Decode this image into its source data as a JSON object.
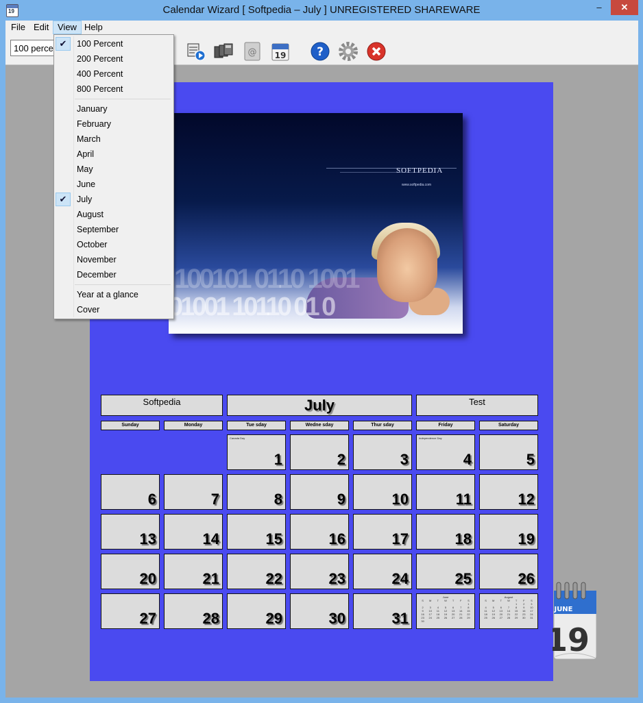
{
  "window": {
    "title": "Calendar Wizard [ Softpedia – July ]  UNREGISTERED SHAREWARE",
    "app_icon_text": "19",
    "minimize": "–",
    "maximize": "□",
    "close": "✕"
  },
  "menubar": {
    "file": "File",
    "edit": "Edit",
    "view": "View",
    "help": "Help"
  },
  "toolbar": {
    "zoom_value": "100 percent",
    "icons": [
      "print-preview-icon",
      "print-all-icon",
      "address-book-icon",
      "calendar-19-icon",
      "help-icon",
      "settings-icon",
      "exit-icon"
    ]
  },
  "view_menu": {
    "zoom_items": [
      {
        "label": "100 Percent",
        "checked": true
      },
      {
        "label": "200 Percent",
        "checked": false
      },
      {
        "label": "400 Percent",
        "checked": false
      },
      {
        "label": "800 Percent",
        "checked": false
      }
    ],
    "month_items": [
      {
        "label": "January",
        "checked": false
      },
      {
        "label": "February",
        "checked": false
      },
      {
        "label": "March",
        "checked": false
      },
      {
        "label": "April",
        "checked": false
      },
      {
        "label": "May",
        "checked": false
      },
      {
        "label": "June",
        "checked": false
      },
      {
        "label": "July",
        "checked": true
      },
      {
        "label": "August",
        "checked": false
      },
      {
        "label": "September",
        "checked": false
      },
      {
        "label": "October",
        "checked": false
      },
      {
        "label": "November",
        "checked": false
      },
      {
        "label": "December",
        "checked": false
      }
    ],
    "other_items": [
      {
        "label": "Year at a glance"
      },
      {
        "label": "Cover"
      }
    ],
    "check_glyph": "✔"
  },
  "photo": {
    "brand": "SOFTPEDIA",
    "url": "www.softpedia.com",
    "digits": "100101 0110 1001",
    "digits2": "01001 10110 01 0"
  },
  "calendar": {
    "left_header": "Softpedia",
    "month": "July",
    "right_header": "Test",
    "weekdays": [
      "Sunday",
      "Monday",
      "Tue sday",
      "Wedne sday",
      "Thur sday",
      "Friday",
      "Saturday"
    ],
    "first_weekday_index": 2,
    "days": 31,
    "notes": {
      "1": "Canada Day",
      "4": "Independence Day"
    },
    "mini_prev": {
      "title": "June",
      "headers": [
        "S",
        "M",
        "T",
        "W",
        "T",
        "F",
        "S"
      ],
      "rows": [
        [
          "",
          "",
          "",
          "",
          "",
          "",
          "1"
        ],
        [
          "2",
          "3",
          "4",
          "5",
          "6",
          "7",
          "8"
        ],
        [
          "9",
          "10",
          "11",
          "12",
          "13",
          "14",
          "15"
        ],
        [
          "16",
          "17",
          "18",
          "19",
          "20",
          "21",
          "22"
        ],
        [
          "23",
          "24",
          "25",
          "26",
          "27",
          "28",
          "29"
        ],
        [
          "30",
          "",
          "",
          "",
          "",
          "",
          ""
        ]
      ]
    },
    "mini_next": {
      "title": "August",
      "headers": [
        "S",
        "M",
        "T",
        "W",
        "T",
        "F",
        "S"
      ],
      "rows": [
        [
          "",
          "",
          "",
          "",
          "1",
          "2",
          "3"
        ],
        [
          "4",
          "5",
          "6",
          "7",
          "8",
          "9",
          "10"
        ],
        [
          "11",
          "12",
          "13",
          "14",
          "15",
          "16",
          "17"
        ],
        [
          "18",
          "19",
          "20",
          "21",
          "22",
          "23",
          "24"
        ],
        [
          "25",
          "26",
          "27",
          "28",
          "29",
          "30",
          "31"
        ]
      ]
    }
  },
  "decoration": {
    "month": "JUNE",
    "day": "19"
  },
  "colors": {
    "page_bg": "#4a4af0",
    "titlebar": "#79b3ea",
    "close_red": "#c7493e",
    "cell_bg": "#dcdcdc"
  }
}
